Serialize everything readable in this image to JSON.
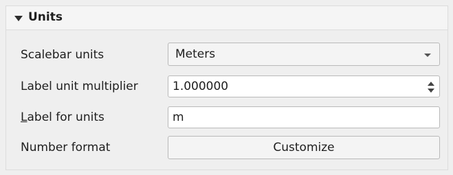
{
  "section": {
    "title": "Units",
    "expand_icon": "triangle-down-icon"
  },
  "scalebar_units": {
    "label": "Scalebar units",
    "value": "Meters",
    "arrow_icon": "chevron-down-icon"
  },
  "label_unit_multiplier": {
    "label": "Label unit multiplier",
    "value": "1.000000"
  },
  "label_for_units": {
    "label_first": "L",
    "label_rest": "abel for units",
    "value": "m"
  },
  "number_format": {
    "label": "Number format",
    "button_label": "Customize"
  }
}
